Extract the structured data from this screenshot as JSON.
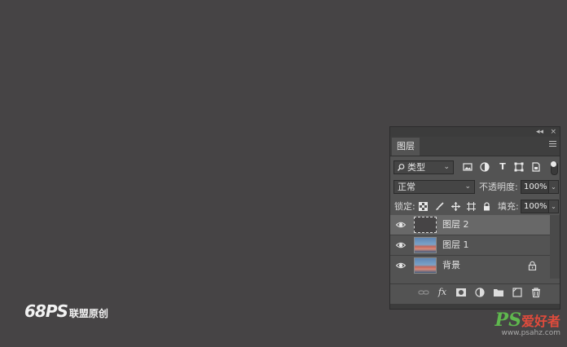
{
  "layers_panel": {
    "collapse_symbol": "◂◂",
    "close_symbol": "×",
    "tab_label": "图层",
    "filter": {
      "search_icon": "search-icon",
      "kind_label": "类型",
      "filter_icons": [
        "image-filter-icon",
        "adjustment-filter-icon",
        "type-filter-icon",
        "shape-filter-icon",
        "smart-object-filter-icon"
      ]
    },
    "blend_mode": "正常",
    "opacity_label": "不透明度:",
    "opacity_value": "100%",
    "lock_label": "锁定:",
    "lock_icons": [
      "lock-transparency-icon",
      "lock-image-icon",
      "lock-position-icon",
      "lock-artboard-icon",
      "lock-all-icon"
    ],
    "fill_label": "填充:",
    "fill_value": "100%",
    "layers": [
      {
        "name": "图层 2",
        "visible": true,
        "selected": true,
        "thumbnail": "empty",
        "locked": false
      },
      {
        "name": "图层 1",
        "visible": true,
        "selected": false,
        "thumbnail": "photo",
        "locked": false
      },
      {
        "name": "背景",
        "visible": true,
        "selected": false,
        "thumbnail": "photo",
        "locked": true
      }
    ],
    "bottom_icons": [
      "link-icon",
      "fx-icon",
      "mask-icon",
      "adjustment-layer-icon",
      "group-folder-icon",
      "new-layer-icon",
      "trash-icon"
    ],
    "fx_label": "fx"
  },
  "watermark_left": {
    "brand": "68PS",
    "sub": "联盟原创"
  },
  "watermark_right": {
    "logo_latin": "PS",
    "logo_cn": "爱好者",
    "url": "www.psahz.com"
  },
  "colors": {
    "canvas": "#464445",
    "panel": "#535353",
    "selected_layer": "#686868",
    "watermark_green": "#5fb84e",
    "watermark_red": "#e04b3c"
  }
}
